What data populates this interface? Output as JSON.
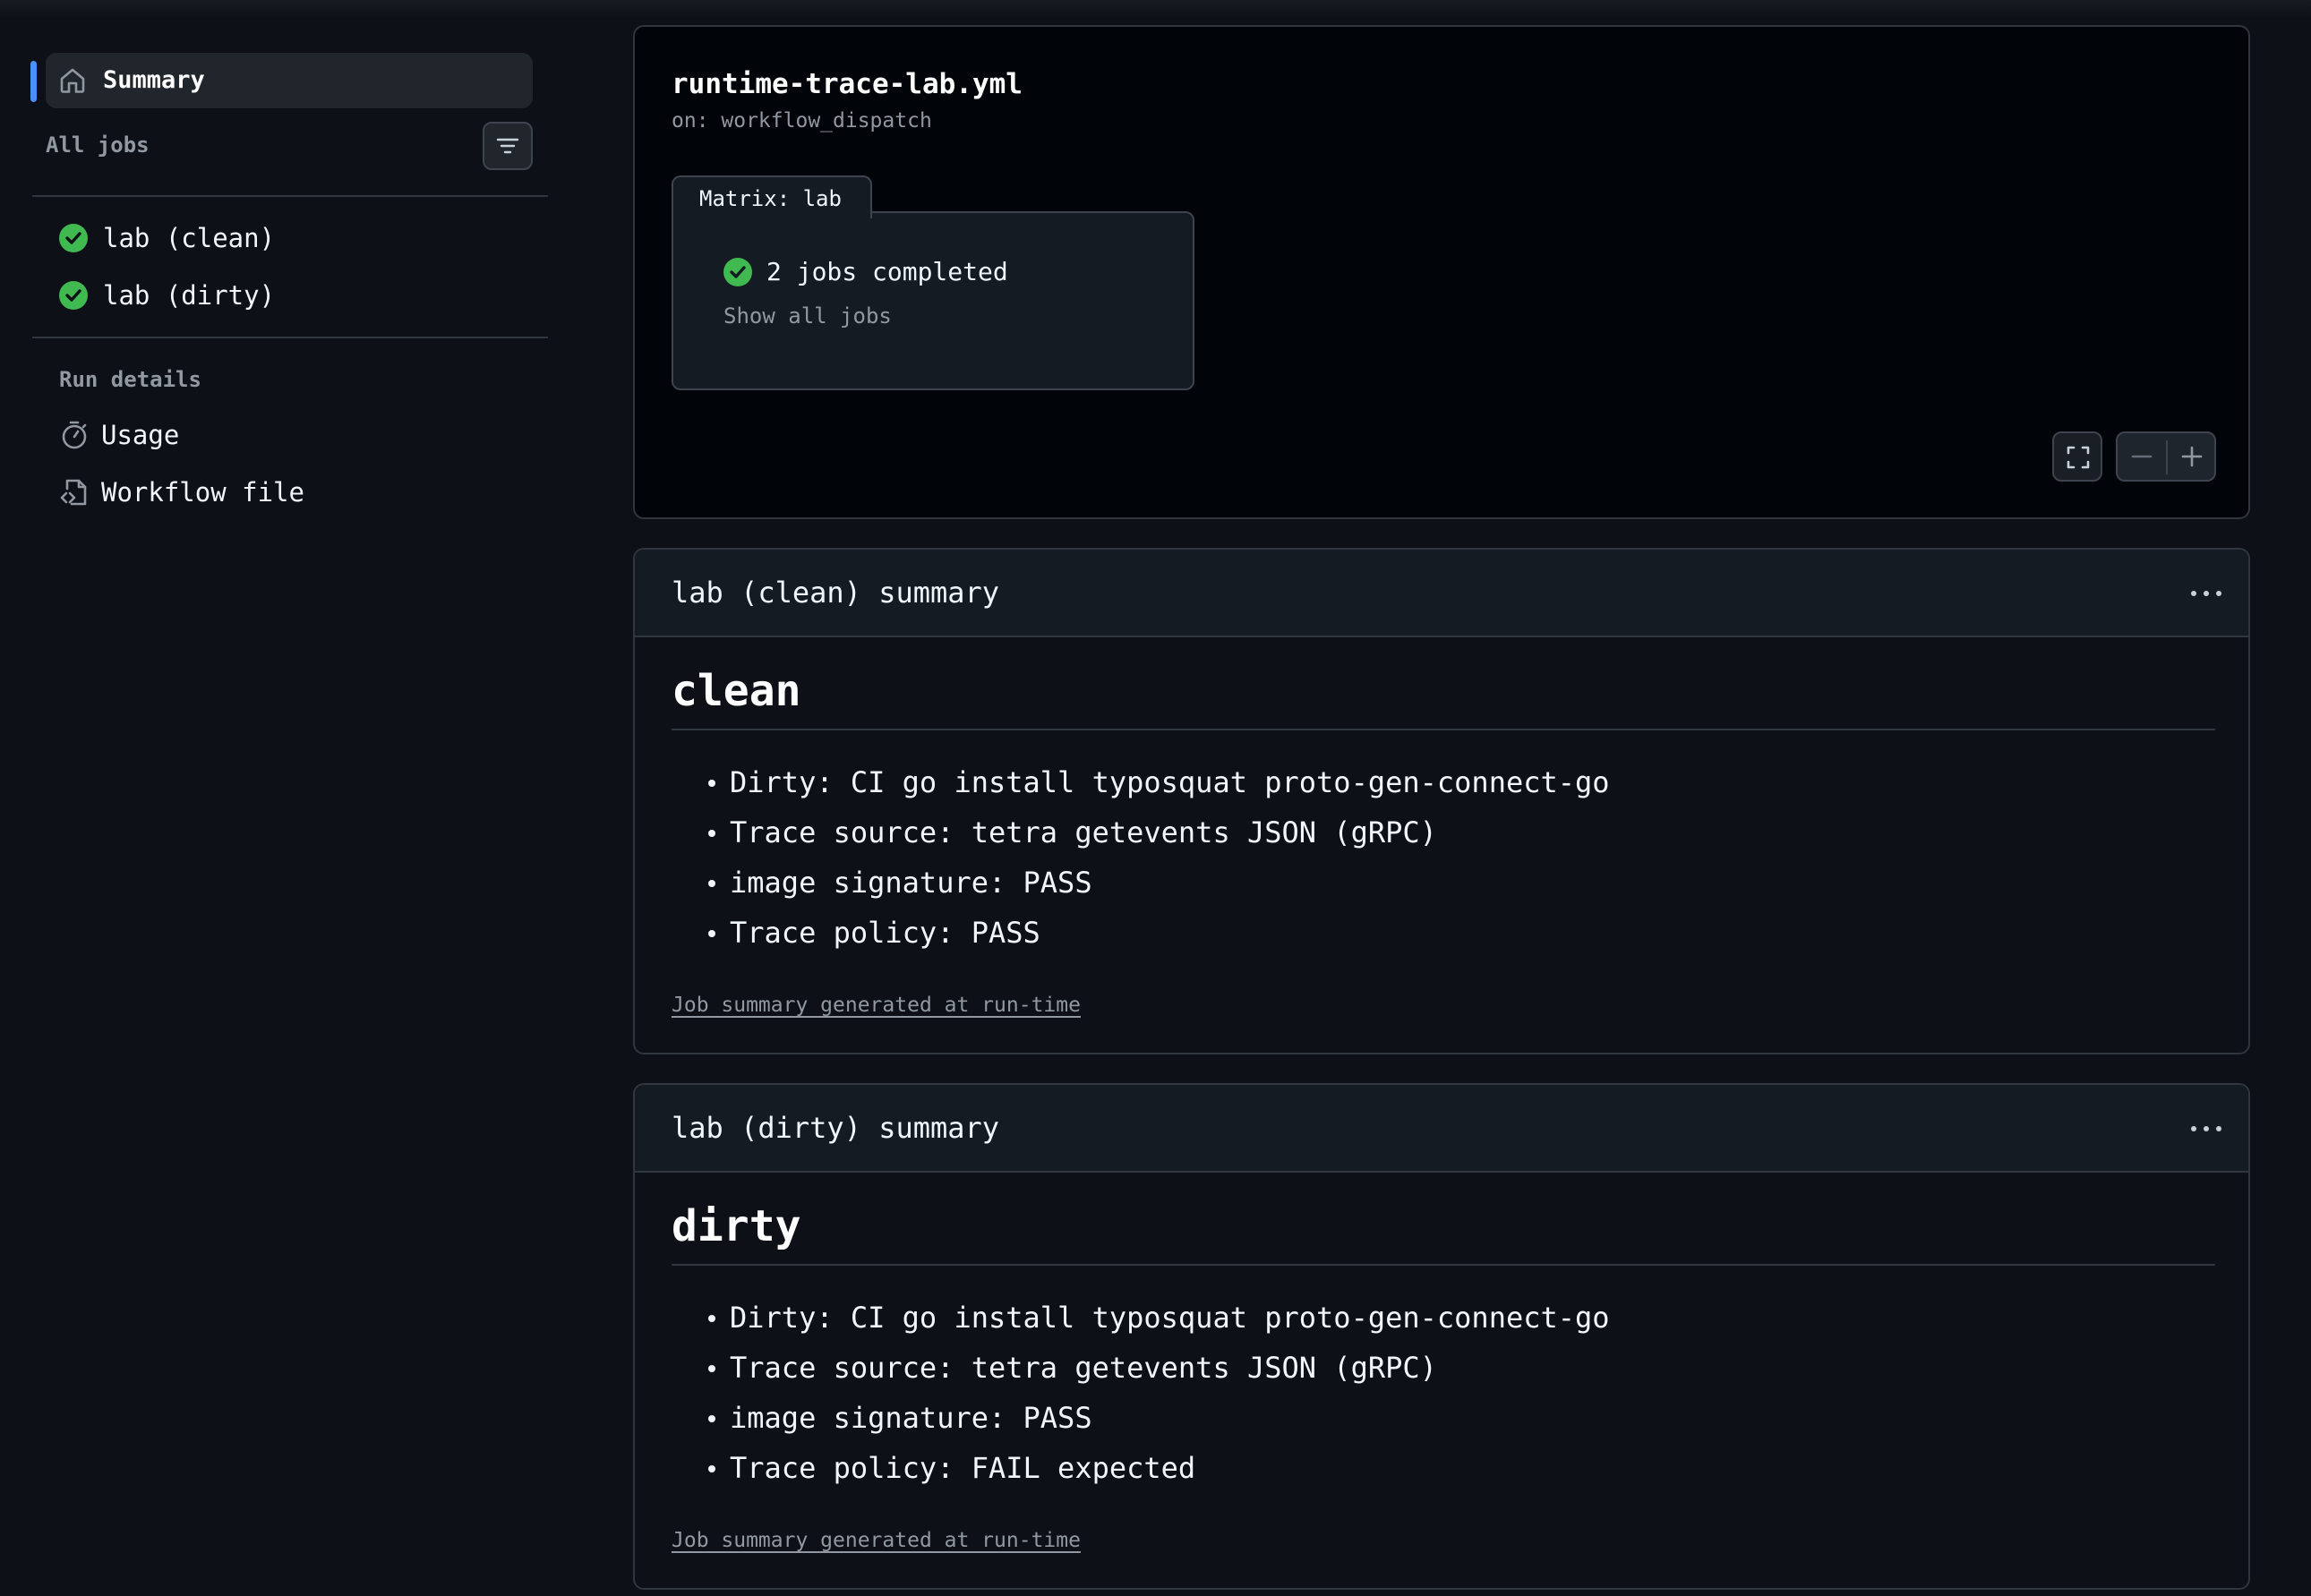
{
  "sidebar": {
    "summary_label": "Summary",
    "all_jobs_label": "All jobs",
    "jobs": [
      {
        "label": "lab (clean)",
        "status": "success"
      },
      {
        "label": "lab (dirty)",
        "status": "success"
      }
    ],
    "run_details_label": "Run details",
    "details": [
      {
        "label": "Usage",
        "icon": "stopwatch-icon"
      },
      {
        "label": "Workflow file",
        "icon": "file-code-icon"
      }
    ]
  },
  "graph": {
    "workflow_name": "runtime-trace-lab.yml",
    "trigger": "on: workflow_dispatch",
    "matrix_label": "Matrix: lab",
    "jobs_completed": "2 jobs completed",
    "show_all": "Show all jobs"
  },
  "summaries": [
    {
      "title": "lab (clean) summary",
      "heading": "clean",
      "items": [
        "Dirty: CI go install typosquat proto-gen-connect-go",
        "Trace source: tetra getevents JSON (gRPC)",
        "image signature: PASS",
        "Trace policy: PASS"
      ],
      "footer": "Job summary generated at run-time"
    },
    {
      "title": "lab (dirty) summary",
      "heading": "dirty",
      "items": [
        "Dirty: CI go install typosquat proto-gen-connect-go",
        "Trace source: tetra getevents JSON (gRPC)",
        "image signature: PASS",
        "Trace policy: FAIL expected"
      ],
      "footer": "Job summary generated at run-time"
    }
  ],
  "colors": {
    "background": "#0d1117",
    "accent": "#4c8dff",
    "success": "#3fb950",
    "muted_text": "#9198a1"
  }
}
